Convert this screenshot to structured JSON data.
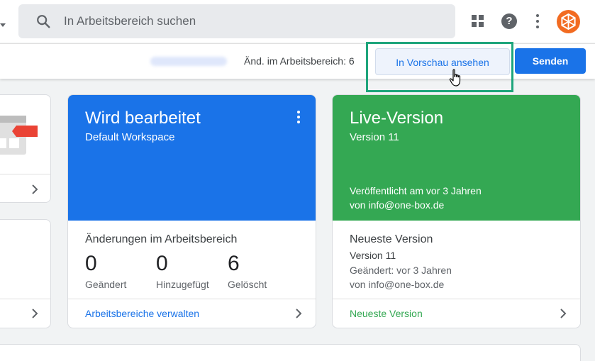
{
  "search": {
    "placeholder": "In Arbeitsbereich suchen"
  },
  "icons": {
    "search": "search-icon",
    "apps": "apps-grid-icon",
    "help": "help-icon",
    "more": "more-vert-icon",
    "avatar": "account-avatar",
    "chevron": "chevron-right-icon",
    "cursor": "hand-pointer-cursor"
  },
  "toolbar": {
    "changes_label": "Änd. im Arbeitsbereich: 6",
    "preview_label": "In Vorschau ansehen",
    "send_label": "Senden"
  },
  "help_glyph": "?",
  "workspace_card": {
    "title": "Wird bearbeitet",
    "subtitle": "Default Workspace",
    "section_label": "Änderungen im Arbeitsbereich",
    "stats": [
      {
        "value": "0",
        "label": "Geändert"
      },
      {
        "value": "0",
        "label": "Hinzugefügt"
      },
      {
        "value": "6",
        "label": "Gelöscht"
      }
    ],
    "link": "Arbeitsbereiche verwalten"
  },
  "live_card": {
    "title": "Live-Version",
    "subtitle": "Version 11",
    "published": "Veröffentlicht am vor 3 Jahren",
    "published_by": "von info@one-box.de",
    "latest_title": "Neueste Version",
    "latest_version": "Version 11",
    "latest_changed": "Geändert: vor 3 Jahren",
    "latest_by": "von info@one-box.de",
    "link": "Neueste Version"
  },
  "colors": {
    "primary_blue": "#1a73e8",
    "live_green": "#34a853",
    "highlight_teal": "#1ea57c",
    "avatar_orange": "#f26b21"
  }
}
